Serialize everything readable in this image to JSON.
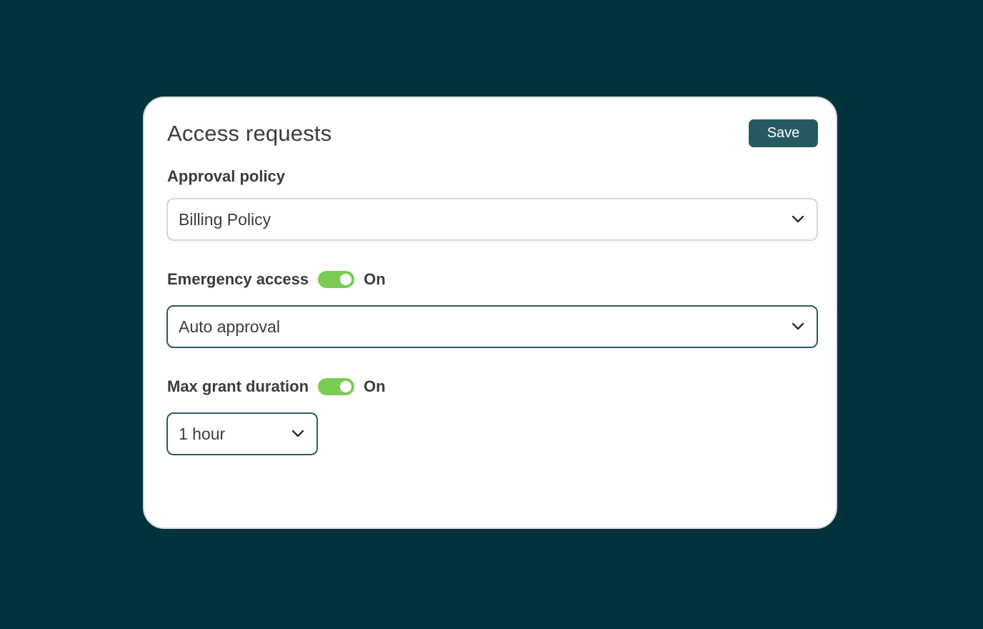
{
  "card": {
    "title": "Access requests",
    "save_label": "Save"
  },
  "approval_policy": {
    "label": "Approval policy",
    "selected": "Billing Policy",
    "icon": "chevron-down-icon"
  },
  "emergency_access": {
    "label": "Emergency access",
    "toggle_on": true,
    "state_text": "On",
    "selected": "Auto approval",
    "icon": "chevron-down-icon"
  },
  "max_grant_duration": {
    "label": "Max grant duration",
    "toggle_on": true,
    "state_text": "On",
    "selected": "1 hour",
    "icon": "chevron-down-icon"
  },
  "colors": {
    "background": "#02333a",
    "accent": "#265a60",
    "toggle_on": "#7ccb55"
  }
}
